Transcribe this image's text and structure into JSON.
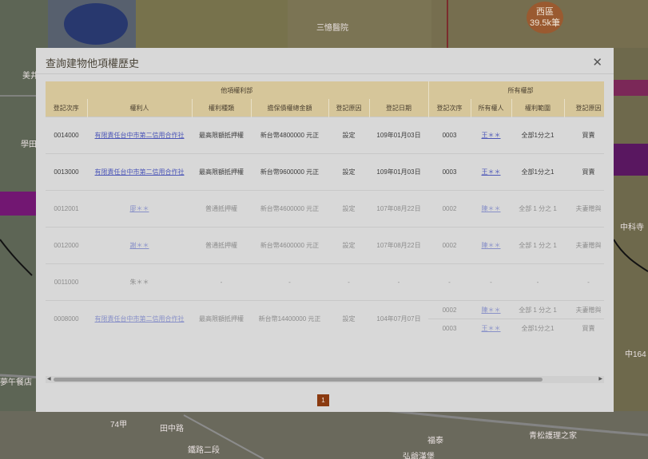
{
  "map": {
    "labels": [
      "美井",
      "學田",
      "夢午餐店",
      "田中路",
      "鐵路二段",
      "福泰",
      "弘爺漢堡",
      "青松護理之家",
      "中科寺",
      "中164",
      "74甲",
      "三憶醫院"
    ],
    "cluster": {
      "name": "西區",
      "count": "39.5k筆"
    }
  },
  "modal": {
    "title": "查詢建物他項權歷史",
    "close_icon": "close-icon",
    "group_headers": {
      "other_rights": "他項權利部",
      "ownership": "所有權部"
    },
    "columns": [
      "登記次序",
      "權利人",
      "權利種類",
      "擔保債權總金額",
      "登記原因",
      "登記日期",
      "登記次序",
      "所有權人",
      "權利範圍",
      "登記原因"
    ],
    "rows": [
      {
        "seq": "0014000",
        "holder": "有限責任台中市第二信用合作社",
        "holder_link": true,
        "type": "最高限額抵押權",
        "amount": "新台幣4800000 元正",
        "reason": "設定",
        "date": "109年01月03日",
        "faded": false,
        "owners": [
          {
            "seq": "0003",
            "owner": "王＊＊",
            "scope": "全部1分之1",
            "reason": "買賣"
          }
        ]
      },
      {
        "seq": "0013000",
        "holder": "有限責任台中市第二信用合作社",
        "holder_link": true,
        "type": "最高限額抵押權",
        "amount": "新台幣9600000 元正",
        "reason": "設定",
        "date": "109年01月03日",
        "faded": false,
        "owners": [
          {
            "seq": "0003",
            "owner": "王＊＊",
            "scope": "全部1分之1",
            "reason": "買賣"
          }
        ]
      },
      {
        "seq": "0012001",
        "holder": "廖＊＊",
        "holder_link": true,
        "type": "普通抵押權",
        "amount": "新台幣4600000 元正",
        "reason": "設定",
        "date": "107年08月22日",
        "faded": true,
        "owners": [
          {
            "seq": "0002",
            "owner": "陳＊＊",
            "scope": "全部 1 分之 1",
            "reason": "夫妻贈與"
          }
        ]
      },
      {
        "seq": "0012000",
        "holder": "謝＊＊",
        "holder_link": true,
        "type": "普通抵押權",
        "amount": "新台幣4600000 元正",
        "reason": "設定",
        "date": "107年08月22日",
        "faded": true,
        "owners": [
          {
            "seq": "0002",
            "owner": "陳＊＊",
            "scope": "全部 1 分之 1",
            "reason": "夫妻贈與"
          }
        ]
      },
      {
        "seq": "0011000",
        "holder": "朱＊＊",
        "holder_link": false,
        "type": "-",
        "amount": "-",
        "reason": "-",
        "date": "-",
        "faded": true,
        "owners": [
          {
            "seq": "-",
            "owner": "-",
            "scope": "-",
            "reason": "-"
          }
        ]
      },
      {
        "seq": "0008000",
        "holder": "有限責任台中市第二信用合作社",
        "holder_link": true,
        "type": "最高限額抵押權",
        "amount": "新台幣14400000 元正",
        "reason": "設定",
        "date": "104年07月07日",
        "faded": true,
        "owners": [
          {
            "seq": "0002",
            "owner": "陳＊＊",
            "scope": "全部 1 分之 1",
            "reason": "夫妻贈與"
          },
          {
            "seq": "0003",
            "owner": "王＊＊",
            "scope": "全部1分之1",
            "reason": "買賣"
          }
        ]
      }
    ],
    "pagination": {
      "current": "1"
    }
  }
}
